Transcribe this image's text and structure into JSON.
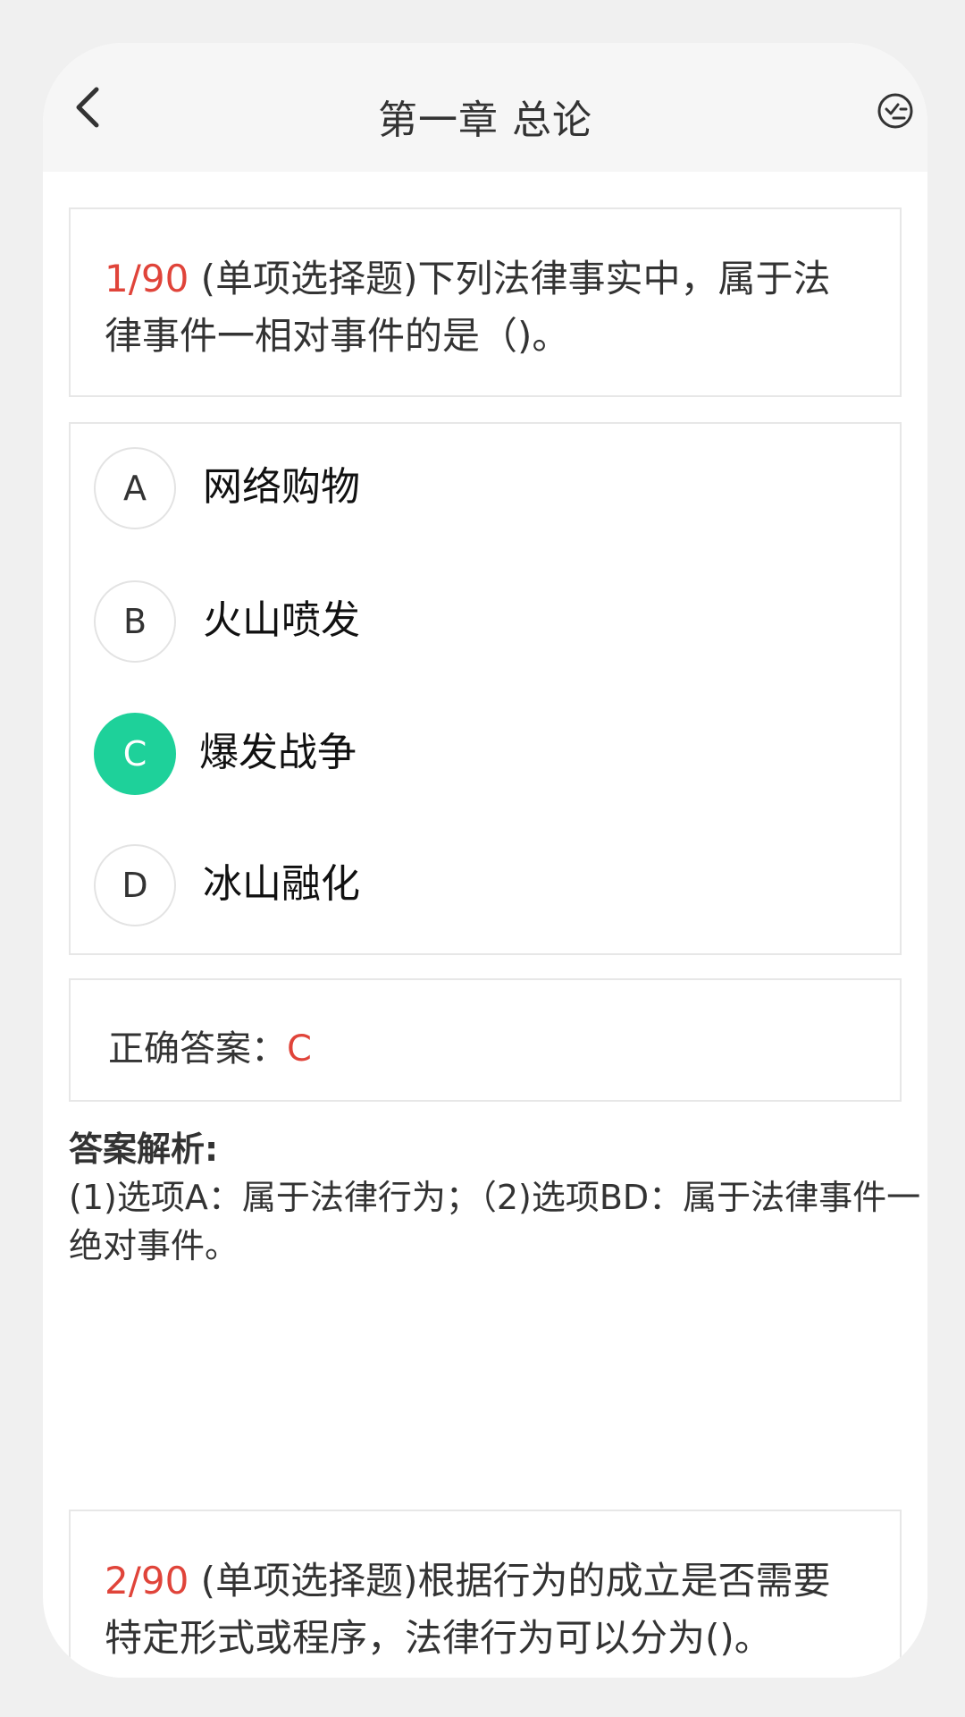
{
  "header": {
    "title": "第一章 总论",
    "back_icon": "chevron-left-icon",
    "action_icon": "checklist-icon"
  },
  "question1": {
    "number": "1/90",
    "text": " (单项选择题)下列法律事实中，属于法律事件一相对事件的是（)。"
  },
  "options": [
    {
      "letter": "A",
      "text": "网络购物",
      "selected": false
    },
    {
      "letter": "B",
      "text": "火山喷发",
      "selected": false
    },
    {
      "letter": "C",
      "text": "爆发战争",
      "selected": true
    },
    {
      "letter": "D",
      "text": "冰山融化",
      "selected": false
    }
  ],
  "answer": {
    "label": "正确答案：",
    "value": "C"
  },
  "analysis": {
    "title": "答案解析:",
    "text": "(1)选项A：属于法律行为；（2)选项BD：属于法律事件一绝对事件。"
  },
  "question2": {
    "number": "2/90",
    "text": " (单项选择题)根据行为的成立是否需要特定形式或程序，法律行为可以分为()。"
  },
  "colors": {
    "accent_red": "#e0443a",
    "selected_green": "#1ed19a",
    "header_bg": "#f6f6f6"
  }
}
